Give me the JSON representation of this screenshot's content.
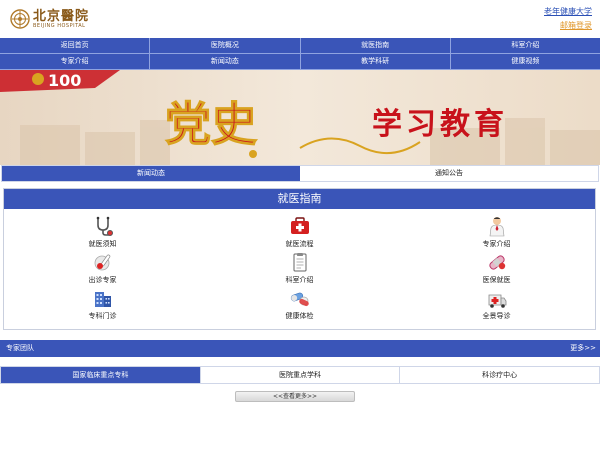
{
  "header": {
    "logo_cn": "北京醫院",
    "logo_en": "BEIJING HOSPITAL",
    "link_university": "老年健康大学",
    "link_email": "邮箱登录"
  },
  "nav": {
    "row1": [
      "返回首页",
      "医院概况",
      "就医指南",
      "科室介绍"
    ],
    "row2": [
      "专家介绍",
      "新闻动态",
      "教学科研",
      "健康视频"
    ]
  },
  "banner": {
    "logo_number": "100",
    "title_calligraphy": "党史",
    "title_rest": "学习教育",
    "colors": {
      "bg": "#efe3d2",
      "red": "#c8121b",
      "gold": "#d9a320"
    }
  },
  "news_tabs": [
    {
      "label": "新闻动态",
      "active": true
    },
    {
      "label": "通知公告",
      "active": false
    }
  ],
  "guide": {
    "title": "就医指南",
    "items": [
      {
        "label": "就医须知",
        "icon": "stethoscope-icon"
      },
      {
        "label": "就医流程",
        "icon": "medical-kit-icon"
      },
      {
        "label": "专家介绍",
        "icon": "doctor-icon"
      },
      {
        "label": "出诊专家",
        "icon": "thermometer-icon"
      },
      {
        "label": "科室介绍",
        "icon": "clipboard-icon"
      },
      {
        "label": "医保就医",
        "icon": "bandage-icon"
      },
      {
        "label": "专科门诊",
        "icon": "hospital-building-icon"
      },
      {
        "label": "健康体检",
        "icon": "pills-icon"
      },
      {
        "label": "全景导诊",
        "icon": "ambulance-icon"
      }
    ]
  },
  "team": {
    "title": "专家团队",
    "more": "更多>>"
  },
  "dept_tabs": [
    {
      "label": "国家临床重点专科",
      "active": true
    },
    {
      "label": "医院重点学科",
      "active": false
    },
    {
      "label": "科诊疗中心",
      "active": false
    }
  ],
  "more_button": "<<查看更多>>",
  "colors": {
    "nav_blue": "#3a55b8",
    "accent_orange": "#e0962a",
    "link_blue": "#2a4fb5"
  }
}
